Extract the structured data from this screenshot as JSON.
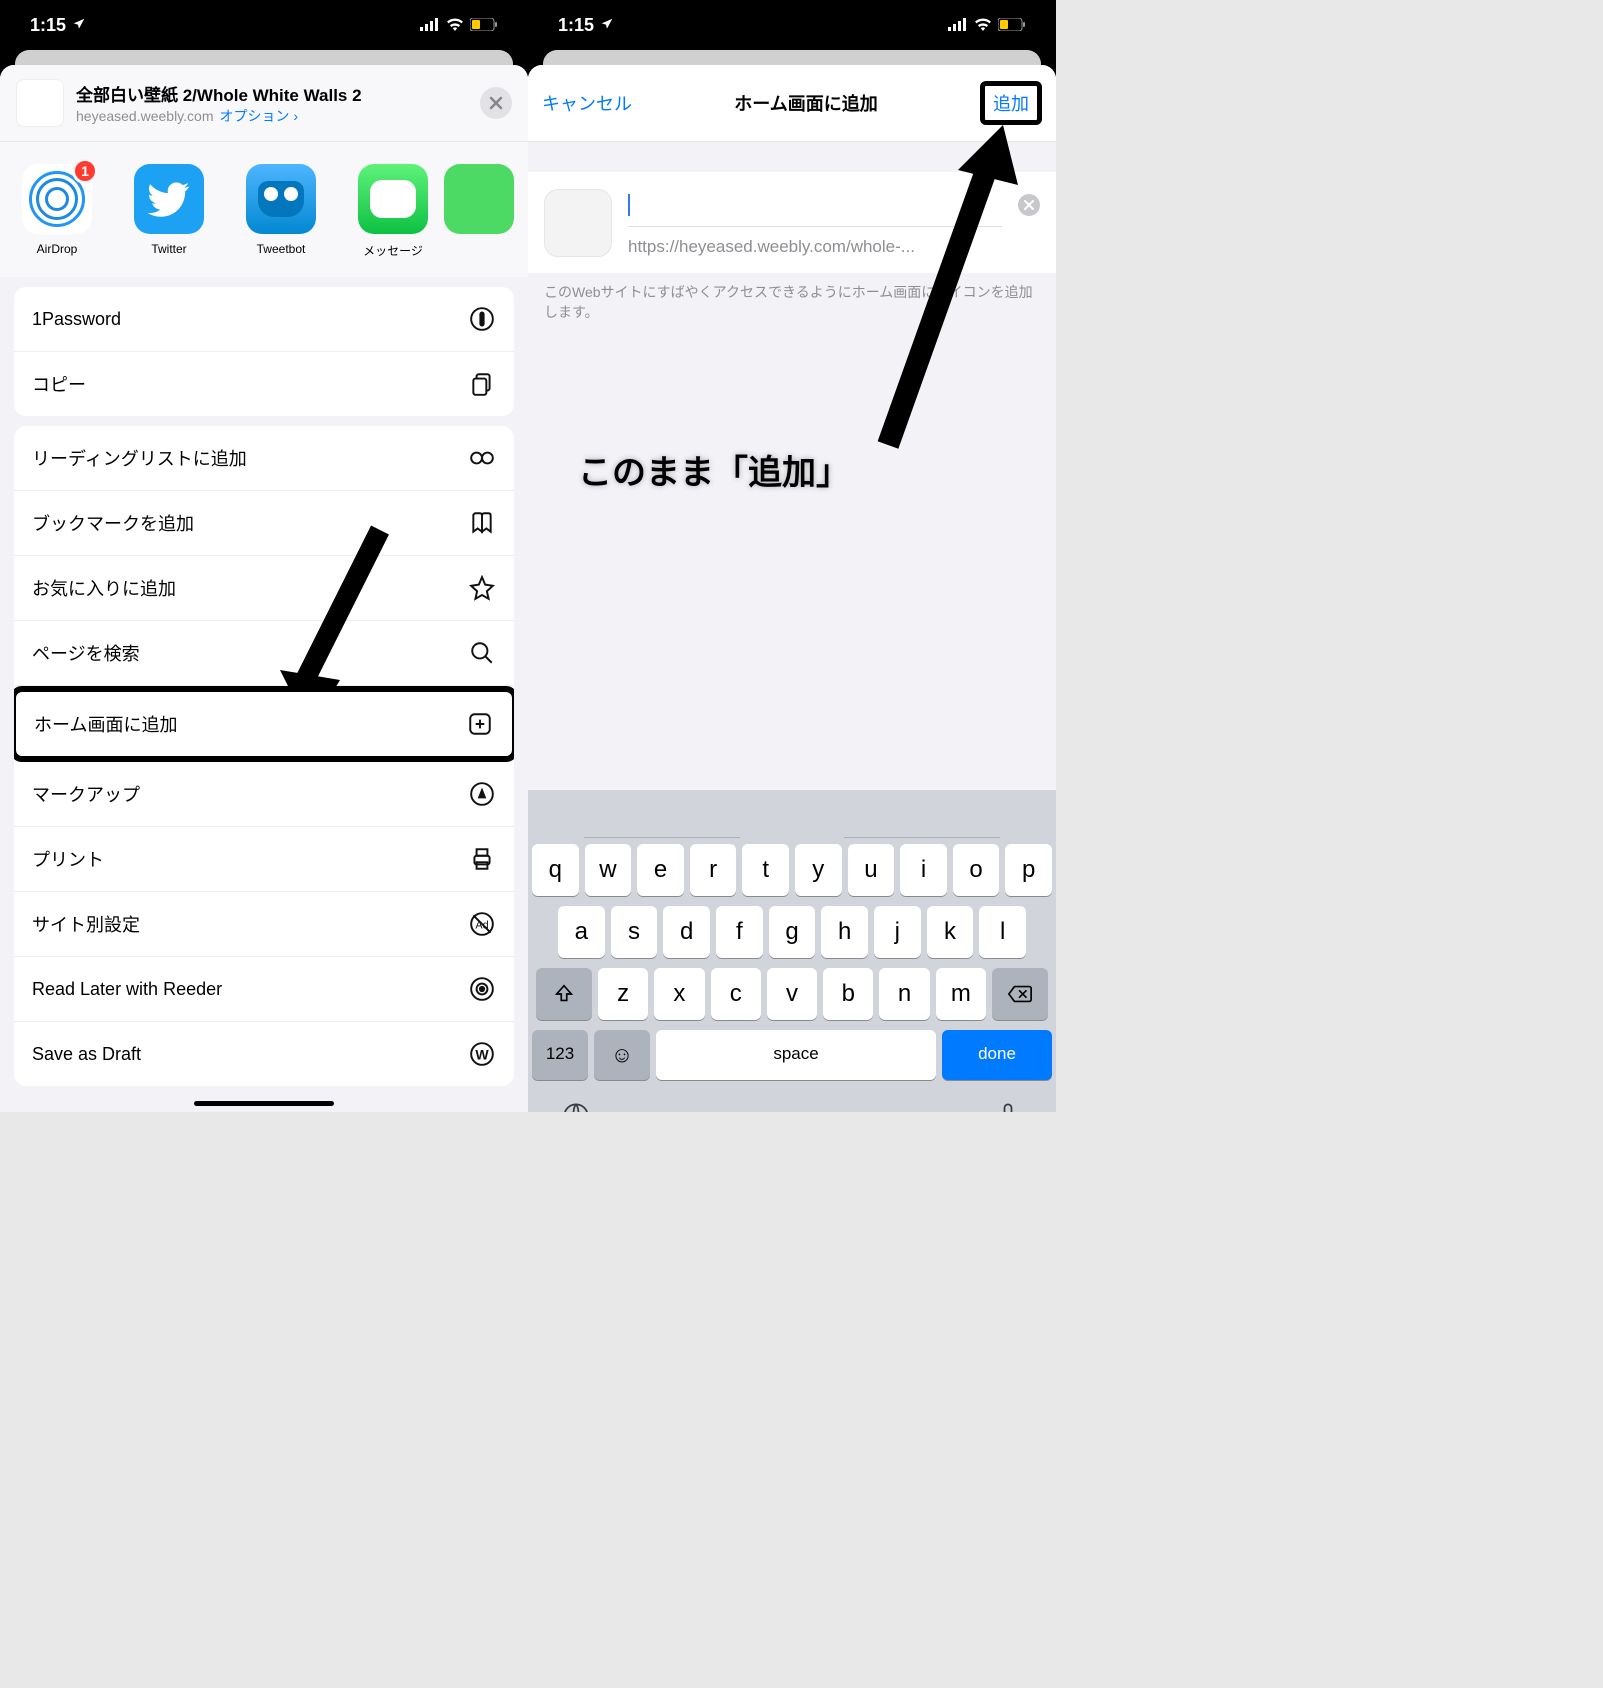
{
  "status": {
    "time": "1:15",
    "battery_low": true
  },
  "share": {
    "title": "全部白い壁紙 2/Whole White Walls 2",
    "domain": "heyeased.weebly.com",
    "options": "オプション",
    "airdrop_badge": "1",
    "apps": {
      "airdrop": "AirDrop",
      "twitter": "Twitter",
      "tweetbot": "Tweetbot",
      "messages": "メッセージ"
    }
  },
  "actions": {
    "onepassword": "1Password",
    "copy": "コピー",
    "reading_list": "リーディングリストに追加",
    "bookmark": "ブックマークを追加",
    "favorite": "お気に入りに追加",
    "find": "ページを検索",
    "home": "ホーム画面に追加",
    "markup": "マークアップ",
    "print": "プリント",
    "site_settings": "サイト別設定",
    "read_later": "Read Later with Reeder",
    "save_draft": "Save as Draft"
  },
  "add_home": {
    "cancel": "キャンセル",
    "title": "ホーム画面に追加",
    "add": "追加",
    "url": "https://heyeased.weebly.com/whole-...",
    "help": "このWebサイトにすばやくアクセスできるようにホーム画面にアイコンを追加します。"
  },
  "keyboard": {
    "row1": [
      "q",
      "w",
      "e",
      "r",
      "t",
      "y",
      "u",
      "i",
      "o",
      "p"
    ],
    "row2": [
      "a",
      "s",
      "d",
      "f",
      "g",
      "h",
      "j",
      "k",
      "l"
    ],
    "row3": [
      "z",
      "x",
      "c",
      "v",
      "b",
      "n",
      "m"
    ],
    "numbers": "123",
    "space": "space",
    "done": "done"
  },
  "annotation": "このまま「追加」"
}
